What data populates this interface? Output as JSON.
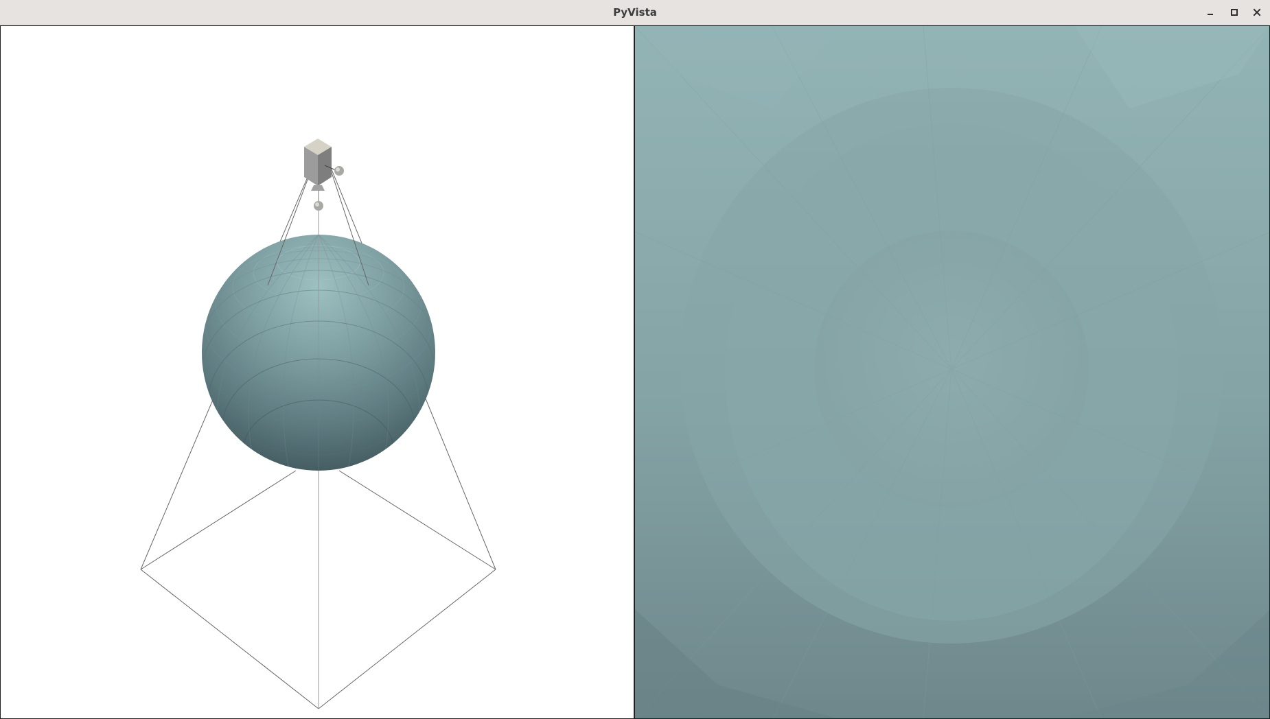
{
  "window": {
    "title": "PyVista",
    "controls": {
      "minimize": "minimize-icon",
      "maximize": "maximize-icon",
      "close": "close-icon"
    }
  },
  "viewports": {
    "left": {
      "background": "#ffffff",
      "objects": [
        "camera-icon",
        "sphere-mesh",
        "view-frustum"
      ]
    },
    "right": {
      "background": "#8aa8aa",
      "objects": [
        "sphere-closeup-mesh"
      ]
    }
  },
  "colors": {
    "mesh": "#8fb0b2",
    "frustum_lines": "#555555",
    "camera_body": "#8c8c8c"
  }
}
